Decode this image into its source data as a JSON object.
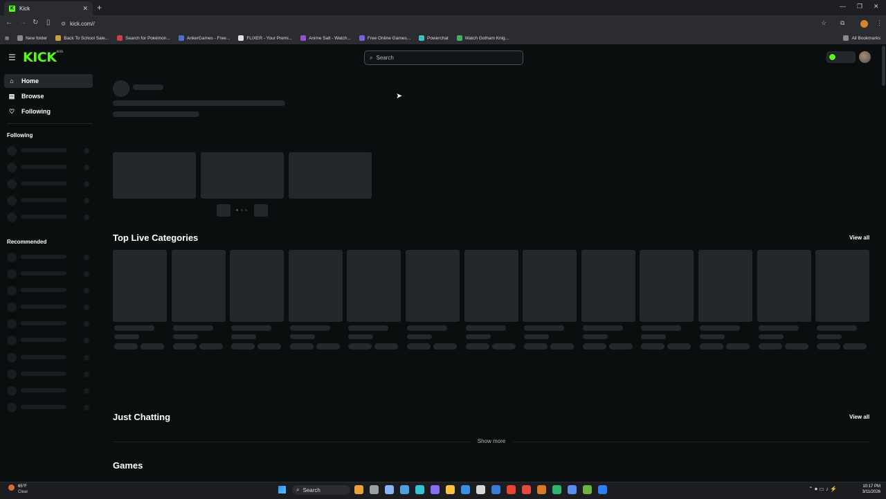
{
  "browser": {
    "tab_title": "Kick",
    "tab_favicon": "K",
    "url": "kick.com//",
    "bookmarks": [
      {
        "label": "New folder",
        "color": "#8a8a8a"
      },
      {
        "label": "Back To School Sale...",
        "color": "#c8a040"
      },
      {
        "label": "Search for Pokémon...",
        "color": "#d04040"
      },
      {
        "label": "AnkerGames - Free...",
        "color": "#4f6fd0"
      },
      {
        "label": "FLIXER - Your Premi...",
        "color": "#e0e0e0"
      },
      {
        "label": "Anime Salt - Watch...",
        "color": "#9b4fd0"
      },
      {
        "label": "Free Online Games...",
        "color": "#7a5fe0"
      },
      {
        "label": "Powerchat",
        "color": "#40c0c0"
      },
      {
        "label": "Watch Gotham Knig...",
        "color": "#40b060"
      }
    ],
    "all_bookmarks": "All Bookmarks"
  },
  "header": {
    "logo": "KICK",
    "logo_badge": "BETA",
    "search_placeholder": "Search"
  },
  "sidebar": {
    "nav": [
      {
        "label": "Home",
        "icon": "home-icon"
      },
      {
        "label": "Browse",
        "icon": "browse-icon"
      },
      {
        "label": "Following",
        "icon": "heart-icon"
      }
    ],
    "following_title": "Following",
    "recommended_title": "Recommended"
  },
  "main": {
    "top_live_categories": "Top Live Categories",
    "view_all_1": "View all",
    "just_chatting": "Just Chatting",
    "view_all_2": "View all",
    "show_more": "Show more",
    "games": "Games"
  },
  "taskbar": {
    "weather_temp": "65°F",
    "weather_desc": "Clear",
    "search": "Search",
    "time": "10:17 PM",
    "date": "3/11/2026"
  },
  "colors": {
    "brand": "#53fc18",
    "background": "#0b0e0f",
    "skeleton": "#24272c"
  }
}
